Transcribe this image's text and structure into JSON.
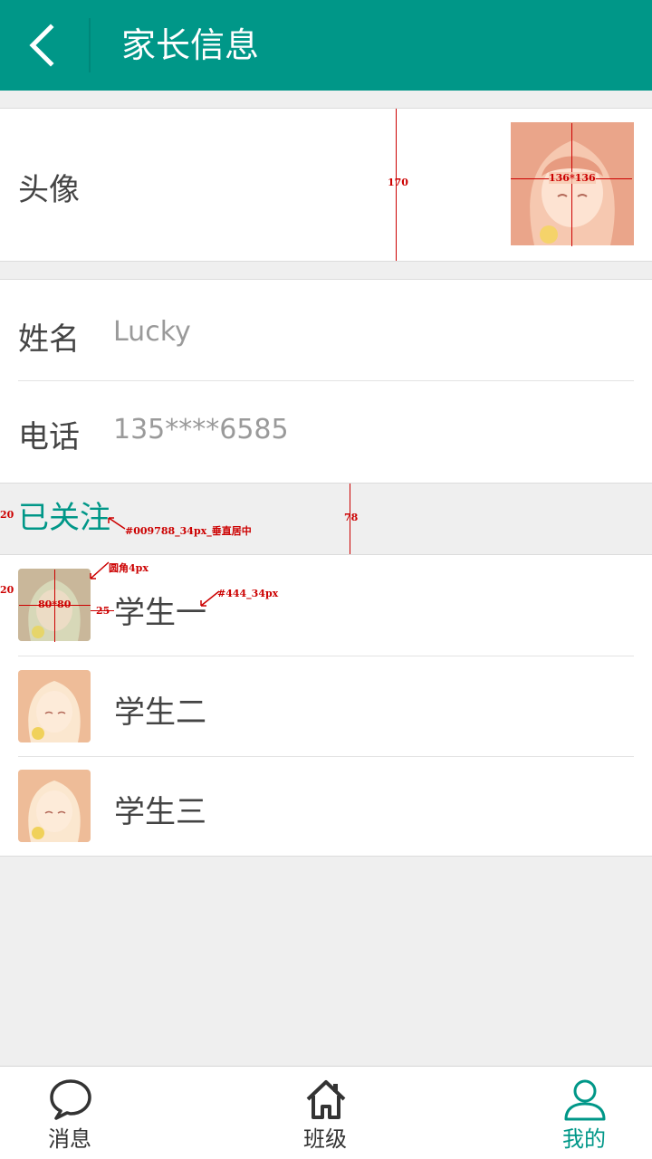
{
  "header": {
    "title": "家长信息"
  },
  "profile": {
    "avatar_label": "头像",
    "name_label": "姓名",
    "name_value": "Lucky",
    "phone_label": "电话",
    "phone_value": "135****6585"
  },
  "following": {
    "title": "已关注",
    "students": [
      {
        "name": "学生一"
      },
      {
        "name": "学生二"
      },
      {
        "name": "学生三"
      }
    ]
  },
  "annotations": {
    "row_height": "170",
    "avatar_size": "136*136",
    "follow_left": "20",
    "follow_style": "#009788_34px_垂直居中",
    "follow_height": "78",
    "radius": "圆角4px",
    "student_left": "20",
    "student_avatar_size": "80*80",
    "student_gap": "25",
    "student_style": "#444_34px"
  },
  "tabbar": {
    "tabs": [
      {
        "label": "消息",
        "icon": "chat-bubble-icon"
      },
      {
        "label": "班级",
        "icon": "home-icon"
      },
      {
        "label": "我的",
        "icon": "person-icon",
        "active": true
      }
    ]
  },
  "colors": {
    "accent": "#009788",
    "text": "#444444",
    "muted": "#9a9a9a",
    "background": "#efefef"
  }
}
